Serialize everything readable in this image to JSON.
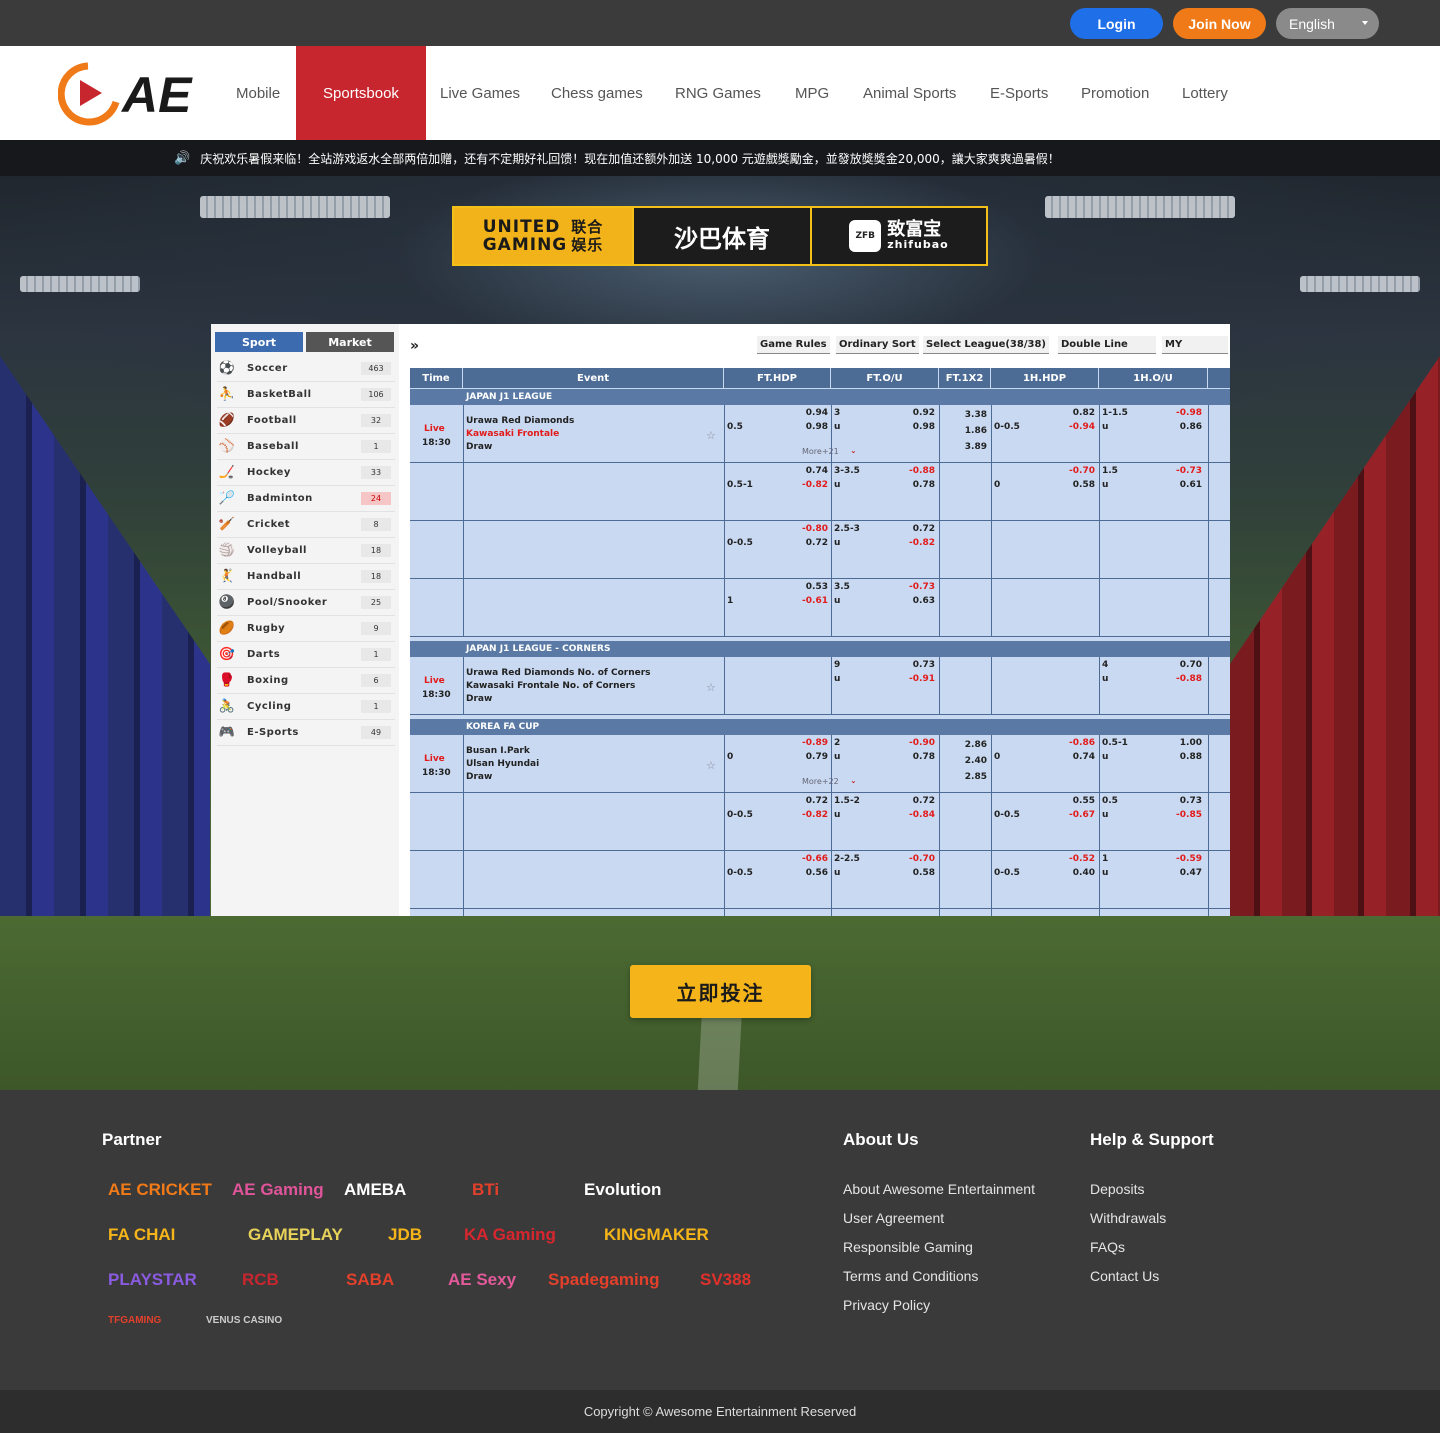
{
  "topbar": {
    "login": "Login",
    "join": "Join Now",
    "language": "English"
  },
  "nav": {
    "items": [
      "Mobile",
      "Sportsbook",
      "Live Games",
      "Chess games",
      "RNG Games",
      "MPG",
      "Animal Sports",
      "E-Sports",
      "Promotion",
      "Lottery"
    ],
    "active": "Sportsbook",
    "logo_text": "AE"
  },
  "ticker": {
    "text": "庆祝欢乐暑假来临！全站游戏返水全部两倍加赠，还有不定期好礼回馈！现在加值还额外加送 10,000 元遊戲獎勵金，並發放獎獎金20,000，讓大家爽爽過暑假！"
  },
  "banner": {
    "b1_line1": "UNITED",
    "b1_line2": "GAMING",
    "b1_cn1": "联合",
    "b1_cn2": "娱乐",
    "b2": "沙巴体育",
    "b3_icon": "ZFB",
    "b3_cn": "致富宝",
    "b3_en": "zhifubao"
  },
  "sportsbook": {
    "tabs": [
      "Sport",
      "Market"
    ],
    "sports": [
      {
        "name": "Soccer",
        "count": "463",
        "icon": "soccer-icon"
      },
      {
        "name": "BasketBall",
        "count": "106",
        "icon": "basketball-icon"
      },
      {
        "name": "Football",
        "count": "32",
        "icon": "football-icon"
      },
      {
        "name": "Baseball",
        "count": "1",
        "icon": "baseball-icon"
      },
      {
        "name": "Hockey",
        "count": "33",
        "icon": "hockey-icon"
      },
      {
        "name": "Badminton",
        "count": "24",
        "icon": "badminton-icon"
      },
      {
        "name": "Cricket",
        "count": "8",
        "icon": "cricket-icon"
      },
      {
        "name": "Volleyball",
        "count": "18",
        "icon": "volleyball-icon"
      },
      {
        "name": "Handball",
        "count": "18",
        "icon": "handball-icon"
      },
      {
        "name": "Pool/Snooker",
        "count": "25",
        "icon": "pool-icon"
      },
      {
        "name": "Rugby",
        "count": "9",
        "icon": "rugby-icon"
      },
      {
        "name": "Darts",
        "count": "1",
        "icon": "darts-icon"
      },
      {
        "name": "Boxing",
        "count": "6",
        "icon": "boxing-icon"
      },
      {
        "name": "Cycling",
        "count": "1",
        "icon": "cycling-icon"
      },
      {
        "name": "E-Sports",
        "count": "49",
        "icon": "esports-icon"
      }
    ],
    "toolbar": {
      "expand": "»",
      "rules": "Game Rules",
      "sort": "Ordinary Sort",
      "league": "Select League(38/38)",
      "line": "Double Line",
      "odds": "MY"
    },
    "headers": [
      "Time",
      "Event",
      "FT.HDP",
      "FT.O/U",
      "FT.1X2",
      "1H.HDP",
      "1H.O/U"
    ],
    "leagues": [
      "JAPAN J1 LEAGUE",
      "JAPAN J1 LEAGUE - CORNERS",
      "KOREA FA CUP"
    ],
    "live": "Live",
    "time": "18:30",
    "m1": {
      "home": "Urawa Red Diamonds",
      "away": "Kawasaki Frontale",
      "draw": "Draw",
      "more": "More+21"
    },
    "m2": {
      "home": "Urawa Red Diamonds No. of Corners",
      "away": "Kawasaki Frontale No. of Corners",
      "draw": "Draw"
    },
    "m3": {
      "home": "Busan I.Park",
      "away": "Ulsan Hyundai",
      "draw": "Draw",
      "more": "More+22"
    },
    "u": "u",
    "odds": {
      "r1": {
        "hdp": "0.5",
        "h1": "0.94",
        "h2": "0.98",
        "ou": "3",
        "o1": "0.92",
        "o2": "0.98",
        "x1": "3.38",
        "x2": "1.86",
        "x3": "3.89",
        "hh": "0-0.5",
        "hh1": "0.82",
        "hh2": "-0.94",
        "hou": "1-1.5",
        "ho1": "-0.98",
        "ho2": "0.86"
      },
      "r2": {
        "hdp": "0.5-1",
        "h1": "0.74",
        "h2": "-0.82",
        "ou": "3-3.5",
        "o1": "-0.88",
        "o2": "0.78",
        "hh": "0",
        "hh1": "-0.70",
        "hh2": "0.58",
        "hou": "1.5",
        "ho1": "-0.73",
        "ho2": "0.61"
      },
      "r3": {
        "hdp": "0-0.5",
        "h1": "-0.80",
        "h2": "0.72",
        "ou": "2.5-3",
        "o1": "0.72",
        "o2": "-0.82"
      },
      "r4": {
        "hdp": "1",
        "h1": "0.53",
        "h2": "-0.61",
        "ou": "3.5",
        "o1": "-0.73",
        "o2": "0.63"
      },
      "c1": {
        "ou": "9",
        "o1": "0.73",
        "o2": "-0.91",
        "hou": "4",
        "ho1": "0.70",
        "ho2": "-0.88"
      },
      "k1": {
        "hdp": "0",
        "h1": "-0.89",
        "h2": "0.79",
        "ou": "2",
        "o1": "-0.90",
        "o2": "0.78",
        "x1": "2.86",
        "x2": "2.40",
        "x3": "2.85",
        "hh": "0",
        "hh1": "-0.86",
        "hh2": "0.74",
        "hou": "0.5-1",
        "ho1": "1.00",
        "ho2": "0.88"
      },
      "k2": {
        "hdp": "0-0.5",
        "h1": "0.72",
        "h2": "-0.82",
        "ou": "1.5-2",
        "o1": "0.72",
        "o2": "-0.84",
        "hh": "0-0.5",
        "hh1": "0.55",
        "hh2": "-0.67",
        "hou": "0.5",
        "ho1": "0.73",
        "ho2": "-0.85"
      },
      "k3": {
        "hdp": "0-0.5",
        "h1": "-0.66",
        "h2": "0.56",
        "ou": "2-2.5",
        "o1": "-0.70",
        "o2": "0.58",
        "hh": "0-0.5",
        "hh1": "-0.52",
        "hh2": "0.40",
        "hou": "1",
        "ho1": "-0.59",
        "ho2": "0.47"
      }
    }
  },
  "cta": "立即投注",
  "footer": {
    "partner_title": "Partner",
    "partners": [
      "AE CRICKET",
      "AE Gaming",
      "AMEBA",
      "BTi",
      "Evolution",
      "FA CHAI",
      "GAMEPLAY",
      "JDB",
      "KA Gaming",
      "KINGMAKER",
      "PLAYSTAR",
      "RCB",
      "SABA",
      "AE Sexy",
      "Spadegaming",
      "SV388",
      "TFGAMING",
      "VENUS CASINO"
    ],
    "about_title": "About Us",
    "about": [
      "About Awesome Entertainment",
      "User Agreement",
      "Responsible Gaming",
      "Terms and Conditions",
      "Privacy Policy"
    ],
    "help_title": "Help & Support",
    "help": [
      "Deposits",
      "Withdrawals",
      "FAQs",
      "Contact Us"
    ],
    "copyright": "Copyright © Awesome Entertainment Reserved"
  },
  "colors": {
    "accent": "#c8262f",
    "login": "#1f6fe8",
    "join": "#f07a18",
    "cta": "#f5b51a",
    "table_header": "#4d6c95",
    "table_bg": "#c9d9f1"
  }
}
